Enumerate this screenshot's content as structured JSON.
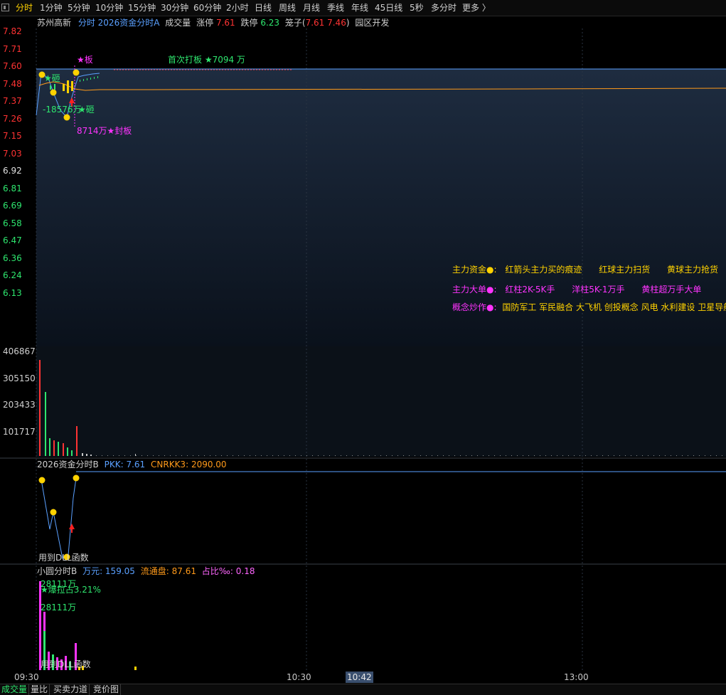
{
  "tabs": [
    {
      "label": "分时",
      "active": true
    },
    {
      "label": "1分钟"
    },
    {
      "label": "5分钟"
    },
    {
      "label": "10分钟"
    },
    {
      "label": "15分钟"
    },
    {
      "label": "30分钟"
    },
    {
      "label": "60分钟"
    },
    {
      "label": "2小时"
    },
    {
      "label": "日线"
    },
    {
      "label": "周线"
    },
    {
      "label": "月线"
    },
    {
      "label": "季线"
    },
    {
      "label": "年线"
    },
    {
      "label": "45日线"
    },
    {
      "label": "5秒"
    },
    {
      "label": "多分时"
    },
    {
      "label": "更多 〉"
    }
  ],
  "main_header": {
    "stock_name": "苏州高新",
    "indicator": "分时 2026资金分时A",
    "volume_label": "成交量",
    "limit_up_label": "涨停",
    "limit_up_value": "7.61",
    "limit_down_label": "跌停",
    "limit_down_value": "6.23",
    "cage_prefix": "笼子(",
    "cage_v1": "7.61",
    "cage_v2": "7.46",
    "cage_suffix": ")",
    "concept": "园区开发"
  },
  "price_axis": {
    "labels": [
      "7.82",
      "7.71",
      "7.60",
      "7.48",
      "7.37",
      "7.26",
      "7.15",
      "7.03",
      "6.92",
      "6.81",
      "6.69",
      "6.58",
      "6.47",
      "6.36",
      "6.24",
      "6.13"
    ],
    "reference": "6.92"
  },
  "annotations": {
    "ban_top": "★板",
    "first_limit": "首次打板 ★7094 万",
    "za1": "★砸",
    "amt_18576": "-18576万",
    "za2": "★砸",
    "seal": "8714万★封板"
  },
  "legend": {
    "row1": [
      {
        "text": "主力资金●:",
        "color": "#ffd200"
      },
      {
        "text": "红箭头主力买的痕迹",
        "color": "#ffd200"
      },
      {
        "text": "红球主力扫货",
        "color": "#ffd200"
      },
      {
        "text": "黄球主力抢货",
        "color": "#ffd200"
      }
    ],
    "row2": [
      {
        "text": "主力大单●:",
        "color": "#ff33ff"
      },
      {
        "text": "红柱2K-5K手",
        "color": "#ff33ff"
      },
      {
        "text": "洋柱5K-1万手",
        "color": "#ff33ff"
      },
      {
        "text": "黄柱超万手大单",
        "color": "#ff33ff"
      }
    ],
    "row3_label": "概念炒作●:",
    "row3_text": "国防军工 军民融合 大飞机 创投概念 风电 水利建设 卫星导航"
  },
  "volume_axis": {
    "labels": [
      "406867",
      "305150",
      "203433",
      "101717"
    ]
  },
  "panel_b": {
    "title": "2026资金分时B",
    "pkk_label": "PKK: ",
    "pkk_value": "7.61",
    "cn_label": "CNRKK3: ",
    "cn_value": "2090.00",
    "footer": "用到DLL函数"
  },
  "panel_c": {
    "title": "小圆分时B",
    "wan_label": "万元: ",
    "wan_value": "159.05",
    "liu_label": "流通盘: ",
    "liu_value": "87.61",
    "zhan_label": "占比‰: ",
    "zhan_value": "0.18",
    "amt1": "28111万",
    "pull": "★爆拉占3.21%",
    "amt2": "28111万",
    "footer": "用到DLL函数"
  },
  "time_axis": [
    "09:30",
    "10:30",
    "10:42",
    "13:00"
  ],
  "bottom_tabs": [
    {
      "label": "成交量",
      "active": true
    },
    {
      "label": "量比"
    },
    {
      "label": "买卖力道"
    },
    {
      "label": "竞价图"
    }
  ],
  "colors": {
    "up": "#ff3333",
    "down": "#2ee66e",
    "price_line": "#5aa0ff",
    "avg_line": "#ff9a1a",
    "yellow": "#ffd200",
    "magenta": "#ff33ff",
    "label_blue": "#5aa0ff"
  }
}
